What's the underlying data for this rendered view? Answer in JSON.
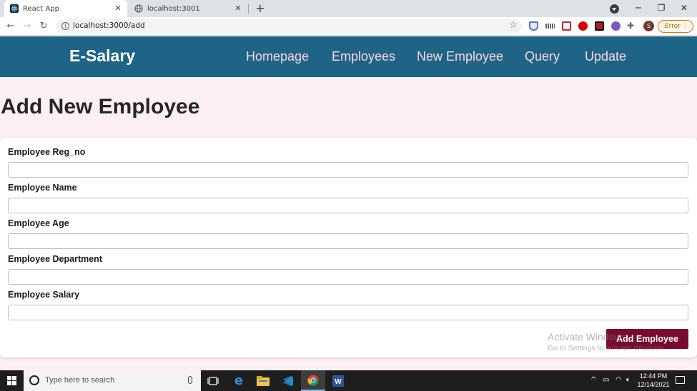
{
  "browser": {
    "tabs": [
      {
        "title": "React App",
        "active": true
      },
      {
        "title": "localhost:3001",
        "active": false
      }
    ],
    "url": "localhost:3000/add",
    "profile_initial": "S",
    "error_label": "Error"
  },
  "navbar": {
    "brand": "E-Salary",
    "links": [
      "Homepage",
      "Employees",
      "New Employee",
      "Query",
      "Update"
    ],
    "bg_color": "#1d6486",
    "link_color": "#ffd6e0"
  },
  "page": {
    "title": "Add New Employee",
    "form": {
      "fields": [
        {
          "label": "Employee Reg_no",
          "value": ""
        },
        {
          "label": "Employee Name",
          "value": ""
        },
        {
          "label": "Employee Age",
          "value": ""
        },
        {
          "label": "Employee Department",
          "value": ""
        },
        {
          "label": "Employee Salary",
          "value": ""
        }
      ],
      "submit_label": "Add Employee",
      "submit_color": "#7a0a2e"
    }
  },
  "watermark": {
    "line1": "Activate Windows",
    "line2": "Go to Settings to activate Windows."
  },
  "taskbar": {
    "search_placeholder": "Type here to search",
    "time": "12:44 PM",
    "date": "12/14/2021"
  }
}
